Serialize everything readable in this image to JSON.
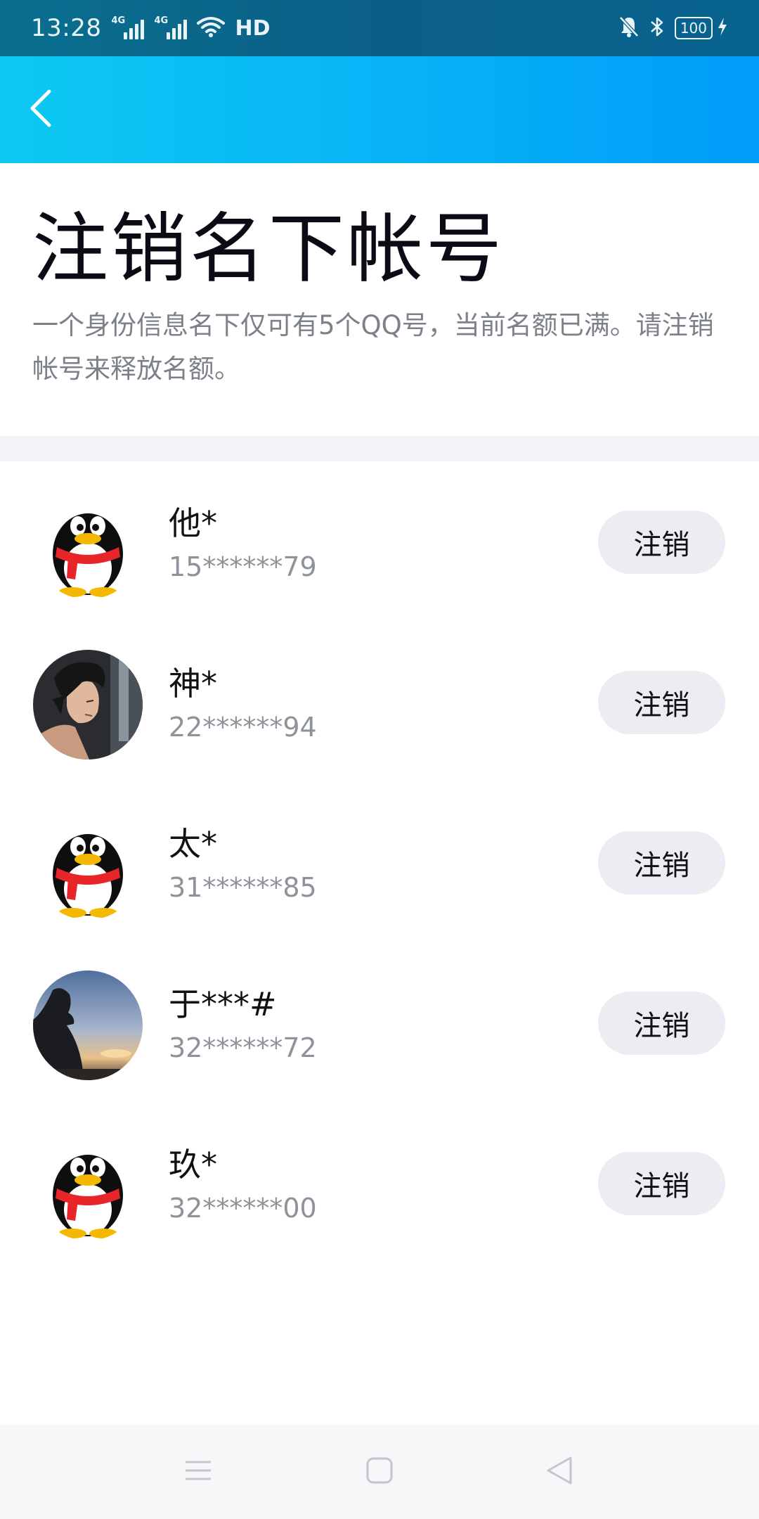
{
  "status_bar": {
    "time": "13:28",
    "signal1_label": "4G",
    "signal2_label": "4G",
    "hd_label": "HD",
    "battery": "100",
    "icons": [
      "wifi-icon",
      "mute-bell-icon",
      "bluetooth-icon",
      "charging-icon"
    ]
  },
  "header": {
    "back_icon": "chevron-left-icon"
  },
  "page": {
    "title": "注销名下帐号",
    "description": "一个身份信息名下仅可有5个QQ号，当前名额已满。请注销帐号来释放名额。"
  },
  "accounts": [
    {
      "name": "他*",
      "number": "15******79",
      "avatar": "qq-penguin-avatar",
      "button": "注销"
    },
    {
      "name": "神*",
      "number": "22******94",
      "avatar": "anime-character-avatar",
      "button": "注销"
    },
    {
      "name": "太*",
      "number": "31******85",
      "avatar": "qq-penguin-avatar",
      "button": "注销"
    },
    {
      "name": "于***#",
      "number": "32******72",
      "avatar": "sunset-silhouette-avatar",
      "button": "注销"
    },
    {
      "name": "玖*",
      "number": "32******00",
      "avatar": "qq-penguin-avatar",
      "button": "注销"
    }
  ],
  "nav_bar": {
    "icons": [
      "menu-icon",
      "home-square-icon",
      "back-triangle-icon"
    ]
  },
  "colors": {
    "header_start": "#0dc9f2",
    "header_end": "#009cf9",
    "status_bar": "#0a5f86",
    "button_bg": "#ebedf3",
    "divider": "#f2f3f7",
    "secondary_text": "#8e929a"
  }
}
